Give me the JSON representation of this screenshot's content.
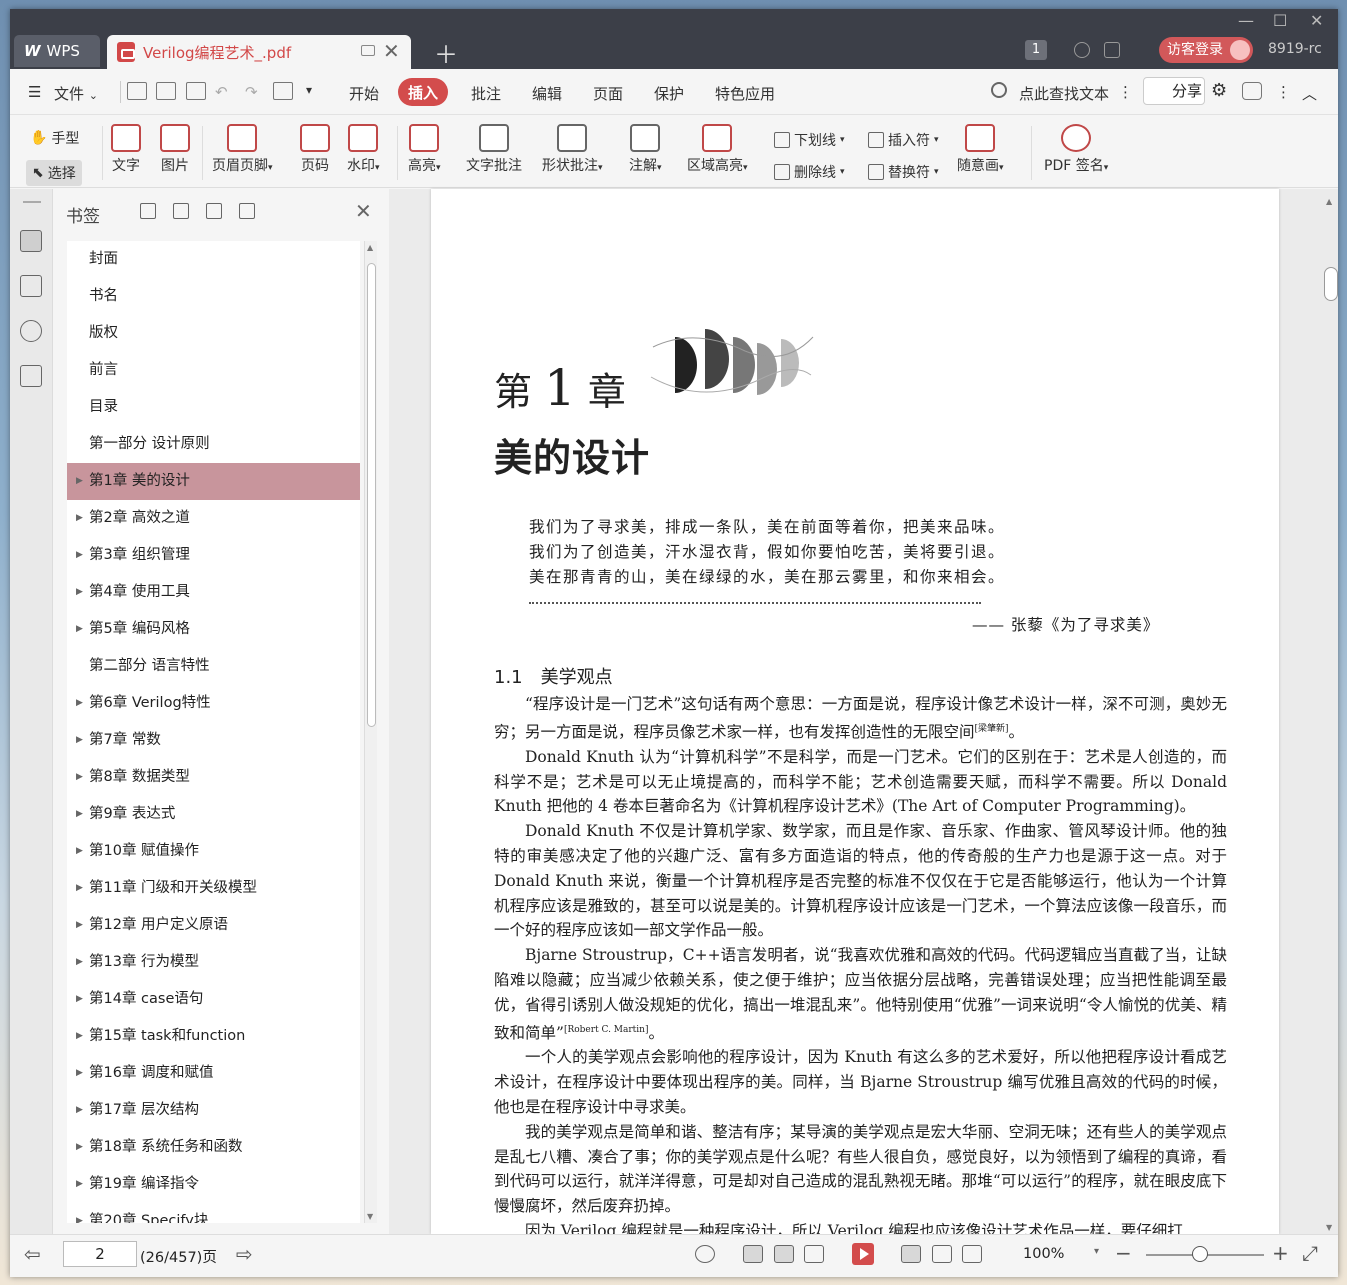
{
  "titlebar": {
    "wps_tab": "WPS",
    "doc_tab": "Verilog编程艺术_.pdf",
    "page_badge": "1",
    "login": "访客登录",
    "version": "8919-rc"
  },
  "menu": {
    "file": "文件",
    "tabs": [
      "开始",
      "插入",
      "批注",
      "编辑",
      "页面",
      "保护",
      "特色应用"
    ],
    "active_tab": "插入",
    "search": "点此查找文本",
    "share": "分享"
  },
  "ribbon": {
    "hand": "手型",
    "select": "选择",
    "text": "文字",
    "image": "图片",
    "header_footer": "页眉页脚",
    "page_number": "页码",
    "watermark": "水印",
    "highlight": "高亮",
    "text_note": "文字批注",
    "shape_note": "形状批注",
    "comment": "注解",
    "area_highlight": "区域高亮",
    "underline": "下划线",
    "strikethrough": "删除线",
    "insert_mark": "插入符",
    "replace_mark": "替换符",
    "freehand": "随意画",
    "pdf_sign": "PDF 签名"
  },
  "bookmarks": {
    "title": "书签",
    "items": [
      {
        "label": "封面",
        "expandable": false
      },
      {
        "label": "书名",
        "expandable": false
      },
      {
        "label": "版权",
        "expandable": false
      },
      {
        "label": "前言",
        "expandable": false
      },
      {
        "label": "目录",
        "expandable": false
      },
      {
        "label": "第一部分 设计原则",
        "expandable": false
      },
      {
        "label": "第1章 美的设计",
        "expandable": true,
        "selected": true
      },
      {
        "label": "第2章 高效之道",
        "expandable": true
      },
      {
        "label": "第3章 组织管理",
        "expandable": true
      },
      {
        "label": "第4章 使用工具",
        "expandable": true
      },
      {
        "label": "第5章 编码风格",
        "expandable": true
      },
      {
        "label": "第二部分 语言特性",
        "expandable": false
      },
      {
        "label": "第6章 Verilog特性",
        "expandable": true
      },
      {
        "label": "第7章 常数",
        "expandable": true
      },
      {
        "label": "第8章 数据类型",
        "expandable": true
      },
      {
        "label": "第9章 表达式",
        "expandable": true
      },
      {
        "label": "第10章 赋值操作",
        "expandable": true
      },
      {
        "label": "第11章 门级和开关级模型",
        "expandable": true
      },
      {
        "label": "第12章 用户定义原语",
        "expandable": true
      },
      {
        "label": "第13章 行为模型",
        "expandable": true
      },
      {
        "label": "第14章 case语句",
        "expandable": true
      },
      {
        "label": "第15章 task和function",
        "expandable": true
      },
      {
        "label": "第16章 调度和赋值",
        "expandable": true
      },
      {
        "label": "第17章 层次结构",
        "expandable": true
      },
      {
        "label": "第18章 系统任务和函数",
        "expandable": true
      },
      {
        "label": "第19章 编译指令",
        "expandable": true
      },
      {
        "label": "第20章 Specify块",
        "expandable": true
      }
    ]
  },
  "page": {
    "chapter_prefix": "第",
    "chapter_num": "1",
    "chapter_suffix": "章",
    "chapter_title": "美的设计",
    "poem": [
      "我们为了寻求美，排成一条队，美在前面等着你，把美来品味。",
      "我们为了创造美，汗水湿衣背，假如你要怕吃苦，美将要引退。",
      "美在那青青的山，美在绿绿的水，美在那云雾里，和你来相会。"
    ],
    "poem_sig": "—— 张藜《为了寻求美》",
    "section": "1.1　美学观点",
    "p1": "“程序设计是一门艺术”这句话有两个意思：一方面是说，程序设计像艺术设计一样，深不可测，奥妙无穷；另一方面是说，程序员像艺术家一样，也有发挥创造性的无限空间",
    "p1_ref": "[梁肇新]",
    "p1_end": "。",
    "p2": "Donald Knuth 认为“计算机科学”不是科学，而是一门艺术。它们的区别在于：艺术是人创造的，而科学不是；艺术是可以无止境提高的，而科学不能；艺术创造需要天赋，而科学不需要。所以 Donald Knuth 把他的 4 卷本巨著命名为《计算机程序设计艺术》(The Art of Computer Programming)。",
    "p3": "Donald Knuth 不仅是计算机学家、数学家，而且是作家、音乐家、作曲家、管风琴设计师。他的独特的审美感决定了他的兴趣广泛、富有多方面造诣的特点，他的传奇般的生产力也是源于这一点。对于 Donald Knuth 来说，衡量一个计算机程序是否完整的标准不仅仅在于它是否能够运行，他认为一个计算机程序应该是雅致的，甚至可以说是美的。计算机程序设计应该是一门艺术，一个算法应该像一段音乐，而一个好的程序应该如一部文学作品一般。",
    "p4": "Bjarne Stroustrup，C++语言发明者，说“我喜欢优雅和高效的代码。代码逻辑应当直截了当，让缺陷难以隐藏；应当减少依赖关系，使之便于维护；应当依据分层战略，完善错误处理；应当把性能调至最优，省得引诱别人做没规矩的优化，搞出一堆混乱来”。他特别使用“优雅”一词来说明“令人愉悦的优美、精致和简单”",
    "p4_ref": "[Robert C. Martin]",
    "p4_end": "。",
    "p5": "一个人的美学观点会影响他的程序设计，因为 Knuth 有这么多的艺术爱好，所以他把程序设计看成艺术设计，在程序设计中要体现出程序的美。同样，当 Bjarne Stroustrup 编写优雅且高效的代码的时候，他也是在程序设计中寻求美。",
    "p6": "我的美学观点是简单和谐、整洁有序；某导演的美学观点是宏大华丽、空洞无味；还有些人的美学观点是乱七八糟、凑合了事；你的美学观点是什么呢？有些人很自负，感觉良好，以为领悟到了编程的真谛，看到代码可以运行，就洋洋得意，可是却对自己造成的混乱熟视无睹。那堆“可以运行”的程序，就在眼皮底下慢慢腐坏，然后废弃扔掉。",
    "p7": "因为 Verilog 编程就是一种程序设计，所以 Verilog 编程也应该像设计艺术作品一样，要仔细打"
  },
  "status": {
    "page_input": "2",
    "page_total": "(26/457)页",
    "zoom": "100%"
  }
}
